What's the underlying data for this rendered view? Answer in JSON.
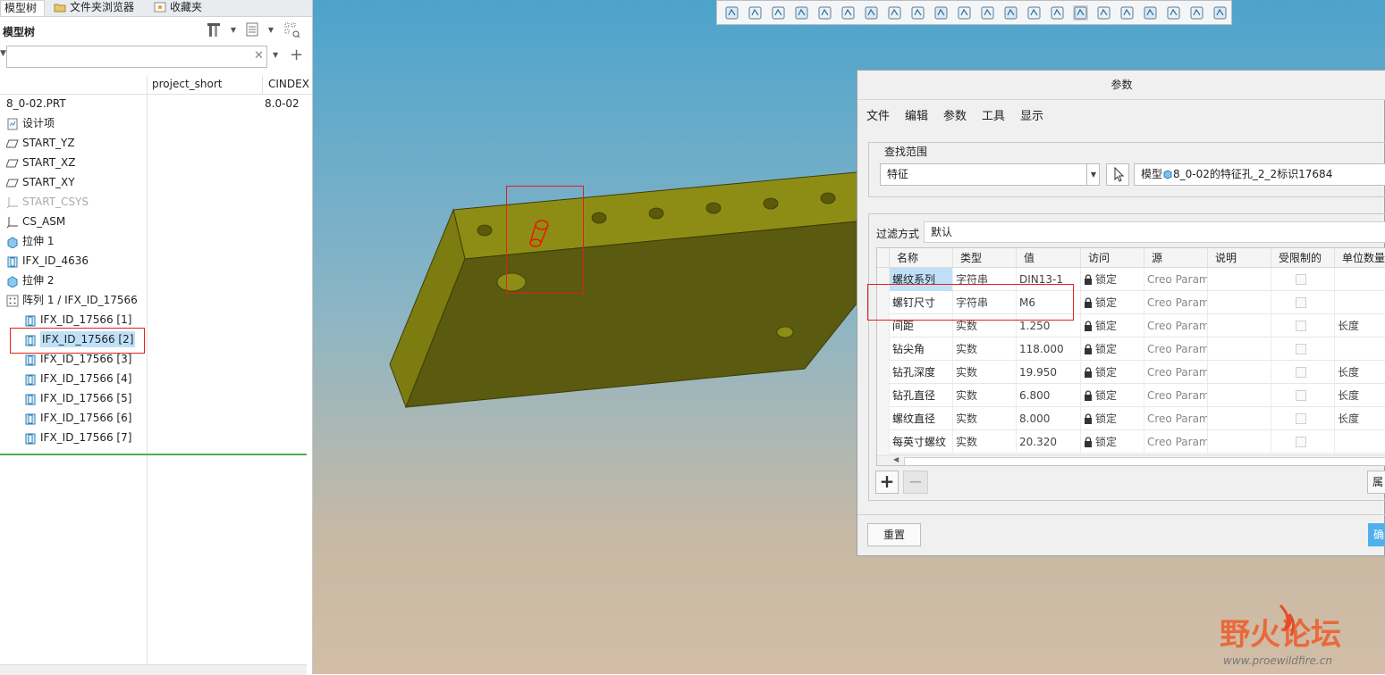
{
  "tabs": [
    "模型树",
    "文件夹浏览器",
    "收藏夹"
  ],
  "model_tree": {
    "title": "模型树",
    "search": {
      "value": "",
      "placeholder": ""
    },
    "columns": [
      "project_short",
      "CINDEX"
    ],
    "root": {
      "label": "8_0-02.PRT",
      "value": "8.0-02"
    },
    "items": [
      {
        "label": "设计项",
        "icon": "design-items-icon",
        "indent": 0,
        "muted": false
      },
      {
        "label": "START_YZ",
        "icon": "datum-plane-icon",
        "indent": 0,
        "muted": false
      },
      {
        "label": "START_XZ",
        "icon": "datum-plane-icon",
        "indent": 0,
        "muted": false
      },
      {
        "label": "START_XY",
        "icon": "datum-plane-icon",
        "indent": 0,
        "muted": false
      },
      {
        "label": "START_CSYS",
        "icon": "csys-icon",
        "indent": 0,
        "muted": true
      },
      {
        "label": "CS_ASM",
        "icon": "csys-icon",
        "indent": 0,
        "muted": false
      },
      {
        "label": "拉伸 1",
        "icon": "extrude-icon",
        "indent": 0,
        "muted": false
      },
      {
        "label": "IFX_ID_4636",
        "icon": "hole-feature-icon",
        "indent": 0,
        "muted": false
      },
      {
        "label": "拉伸 2",
        "icon": "extrude-icon",
        "indent": 0,
        "muted": false
      },
      {
        "label": "阵列 1 / IFX_ID_17566",
        "icon": "pattern-icon",
        "indent": 0,
        "muted": false
      },
      {
        "label": "IFX_ID_17566 [1]",
        "icon": "hole-feature-icon",
        "indent": 1,
        "muted": false
      },
      {
        "label": "IFX_ID_17566 [2]",
        "icon": "hole-feature-icon",
        "indent": 1,
        "muted": false,
        "selected": true
      },
      {
        "label": "IFX_ID_17566 [3]",
        "icon": "hole-feature-icon",
        "indent": 1,
        "muted": false
      },
      {
        "label": "IFX_ID_17566 [4]",
        "icon": "hole-feature-icon",
        "indent": 1,
        "muted": false
      },
      {
        "label": "IFX_ID_17566 [5]",
        "icon": "hole-feature-icon",
        "indent": 1,
        "muted": false
      },
      {
        "label": "IFX_ID_17566 [6]",
        "icon": "hole-feature-icon",
        "indent": 1,
        "muted": false
      },
      {
        "label": "IFX_ID_17566 [7]",
        "icon": "hole-feature-icon",
        "indent": 1,
        "muted": false
      }
    ]
  },
  "dialog": {
    "title": "参数",
    "menu": [
      "文件",
      "编辑",
      "参数",
      "工具",
      "显示"
    ],
    "scope_label": "查找范围",
    "scope_type": "特征",
    "scope_model_prefix": "模型",
    "scope_value": "8_0-02的特征孔_2_2标识17684",
    "filter_label": "过滤方式",
    "filter_value": "默认",
    "columns": [
      "名称",
      "类型",
      "值",
      "访问",
      "源",
      "说明",
      "受限制的",
      "单位数量"
    ],
    "rows": [
      {
        "name": "螺纹系列",
        "type": "字符串",
        "value": "DIN13-1",
        "access": "锁定",
        "source": "Creo Param",
        "unit": ""
      },
      {
        "name": "螺钉尺寸",
        "type": "字符串",
        "value": "M6",
        "access": "锁定",
        "source": "Creo Param",
        "unit": ""
      },
      {
        "name": "间距",
        "type": "实数",
        "value": "1.250",
        "access": "锁定",
        "source": "Creo Param",
        "unit": "长度"
      },
      {
        "name": "钻尖角",
        "type": "实数",
        "value": "118.000",
        "access": "锁定",
        "source": "Creo Param",
        "unit": ""
      },
      {
        "name": "钻孔深度",
        "type": "实数",
        "value": "19.950",
        "access": "锁定",
        "source": "Creo Param",
        "unit": "长度"
      },
      {
        "name": "钻孔直径",
        "type": "实数",
        "value": "6.800",
        "access": "锁定",
        "source": "Creo Param",
        "unit": "长度"
      },
      {
        "name": "螺纹直径",
        "type": "实数",
        "value": "8.000",
        "access": "锁定",
        "source": "Creo Param",
        "unit": "长度"
      },
      {
        "name": "每英寸螺纹",
        "type": "实数",
        "value": "20.320",
        "access": "锁定",
        "source": "Creo Param",
        "unit": ""
      }
    ],
    "properties_btn": "属",
    "reset_btn": "重置",
    "ok_btn": "确"
  },
  "watermark": {
    "title": "野火论坛",
    "url": "www.proewildfire.cn"
  },
  "colors": {
    "selection": "#bfe0f7",
    "highlight_box": "#e02020",
    "part_face": "#5a5a10",
    "part_edge": "#8d8d16",
    "primary_button": "#4fb1ec"
  }
}
